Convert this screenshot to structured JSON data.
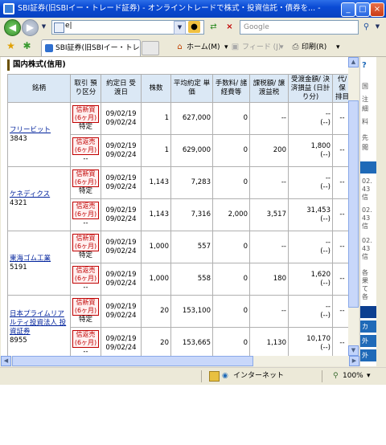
{
  "window": {
    "title": "SBI証券(旧SBIイー・トレード証券) - オンライントレードで株式・投資信託・債券を... - Wind...",
    "min": "_",
    "max": "□",
    "close": "×"
  },
  "nav": {
    "address": "e|",
    "search_placeholder": "Google"
  },
  "tabs": [
    {
      "label": "SBI証券(旧SBIイー・トレー..."
    }
  ],
  "commands": {
    "home": "ホーム(M)",
    "feed": "フィード (J)",
    "print": "印刷(R)"
  },
  "section": {
    "title": "国内株式(信用)"
  },
  "headers": [
    "銘柄",
    "取引 預り区分",
    "約定日 受渡日",
    "株数",
    "平均約定 単価",
    "手数料/ 諸経費等",
    "課税額/ 譲渡益税",
    "受渡金額/ 決済損益 (日計り分)",
    "代/保 排目"
  ],
  "rows": [
    {
      "name": "フリービット",
      "code": "3843",
      "badge": "信新買 (6ヶ月)",
      "sub": "特定",
      "date1": "09/02/19",
      "date2": "09/02/24",
      "shares": "1",
      "price": "627,000",
      "fee": "0",
      "tax": "--",
      "amt1": "--",
      "amt2": "(--)",
      "last": "--"
    },
    {
      "name": "",
      "code": "",
      "badge": "信返売 (6ヶ月)",
      "sub": "--",
      "date1": "09/02/19",
      "date2": "09/02/24",
      "shares": "1",
      "price": "629,000",
      "fee": "0",
      "tax": "200",
      "amt1": "1,800",
      "amt2": "(--)",
      "last": "--"
    },
    {
      "name": "ケネディクス",
      "code": "4321",
      "badge": "信新買 (6ヶ月)",
      "sub": "特定",
      "date1": "09/02/19",
      "date2": "09/02/24",
      "shares": "1,143",
      "price": "7,283",
      "fee": "0",
      "tax": "--",
      "amt1": "--",
      "amt2": "(--)",
      "last": "--"
    },
    {
      "name": "",
      "code": "",
      "badge": "信返売 (6ヶ月)",
      "sub": "--",
      "date1": "09/02/19",
      "date2": "09/02/24",
      "shares": "1,143",
      "price": "7,316",
      "fee": "2,000",
      "tax": "3,517",
      "amt1": "31,453",
      "amt2": "(--)",
      "last": "--"
    },
    {
      "name": "東海ゴム工業",
      "code": "5191",
      "badge": "信新買 (6ヶ月)",
      "sub": "特定",
      "date1": "09/02/19",
      "date2": "09/02/24",
      "shares": "1,000",
      "price": "557",
      "fee": "0",
      "tax": "--",
      "amt1": "--",
      "amt2": "(--)",
      "last": "--"
    },
    {
      "name": "",
      "code": "",
      "badge": "信返売 (6ヶ月)",
      "sub": "--",
      "date1": "09/02/19",
      "date2": "09/02/24",
      "shares": "1,000",
      "price": "558",
      "fee": "0",
      "tax": "180",
      "amt1": "1,620",
      "amt2": "(--)",
      "last": "--"
    },
    {
      "name": "日本プライムリアルティ投資法人 投資証券",
      "code": "8955",
      "badge": "信新買 (6ヶ月)",
      "sub": "特定",
      "date1": "09/02/19",
      "date2": "09/02/24",
      "shares": "20",
      "price": "153,100",
      "fee": "0",
      "tax": "--",
      "amt1": "--",
      "amt2": "(--)",
      "last": "--"
    },
    {
      "name": "",
      "code": "",
      "badge": "信返売 (6ヶ月)",
      "sub": "--",
      "date1": "09/02/19",
      "date2": "09/02/24",
      "shares": "20",
      "price": "153,665",
      "fee": "0",
      "tax": "1,130",
      "amt1": "10,170",
      "amt2": "(--)",
      "last": "--"
    }
  ],
  "right_panel": {
    "lines": [
      "国",
      "注",
      "細",
      "料",
      "先",
      "閲"
    ],
    "mini": [
      "02.",
      "43",
      "信",
      "02.",
      "43",
      "信",
      "02.",
      "43",
      "信",
      "各",
      "果",
      "て",
      "各"
    ],
    "buttons": [
      "カ",
      "外",
      "外"
    ]
  },
  "status": {
    "zone": "インターネット",
    "zoom": "100%"
  }
}
